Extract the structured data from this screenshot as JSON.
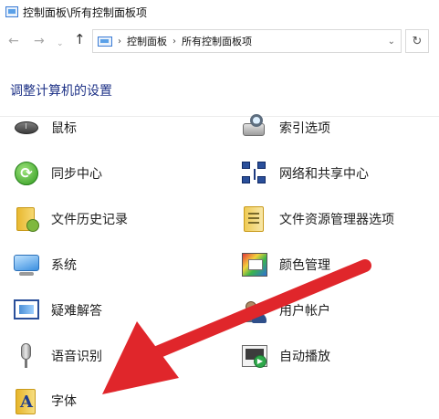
{
  "window": {
    "title": "控制面板\\所有控制面板项"
  },
  "nav": {
    "back_icon": "←",
    "forward_icon": "→",
    "recent_icon": "⌄",
    "up_icon": "↑",
    "refresh_icon": "↻"
  },
  "address": {
    "separator": "›",
    "crumbs": [
      "控制面板",
      "所有控制面板项"
    ],
    "dropdown_icon": "⌄"
  },
  "heading": "调整计算机的设置",
  "items_left": [
    {
      "label": "鼠标",
      "icon": "mouse-icon"
    },
    {
      "label": "同步中心",
      "icon": "sync-center-icon"
    },
    {
      "label": "文件历史记录",
      "icon": "file-history-icon"
    },
    {
      "label": "系统",
      "icon": "system-icon"
    },
    {
      "label": "疑难解答",
      "icon": "troubleshooting-icon"
    },
    {
      "label": "语音识别",
      "icon": "speech-recognition-icon"
    },
    {
      "label": "字体",
      "icon": "fonts-icon"
    }
  ],
  "items_right": [
    {
      "label": "索引选项",
      "icon": "indexing-options-icon"
    },
    {
      "label": "网络和共享中心",
      "icon": "network-sharing-icon"
    },
    {
      "label": "文件资源管理器选项",
      "icon": "explorer-options-icon"
    },
    {
      "label": "颜色管理",
      "icon": "color-management-icon"
    },
    {
      "label": "用户帐户",
      "icon": "user-accounts-icon"
    },
    {
      "label": "自动播放",
      "icon": "autoplay-icon"
    }
  ],
  "colors": {
    "heading": "#1e3287",
    "annotation_arrow": "#e0262b"
  },
  "annotation": {
    "type": "arrow",
    "points_to": "字体"
  }
}
